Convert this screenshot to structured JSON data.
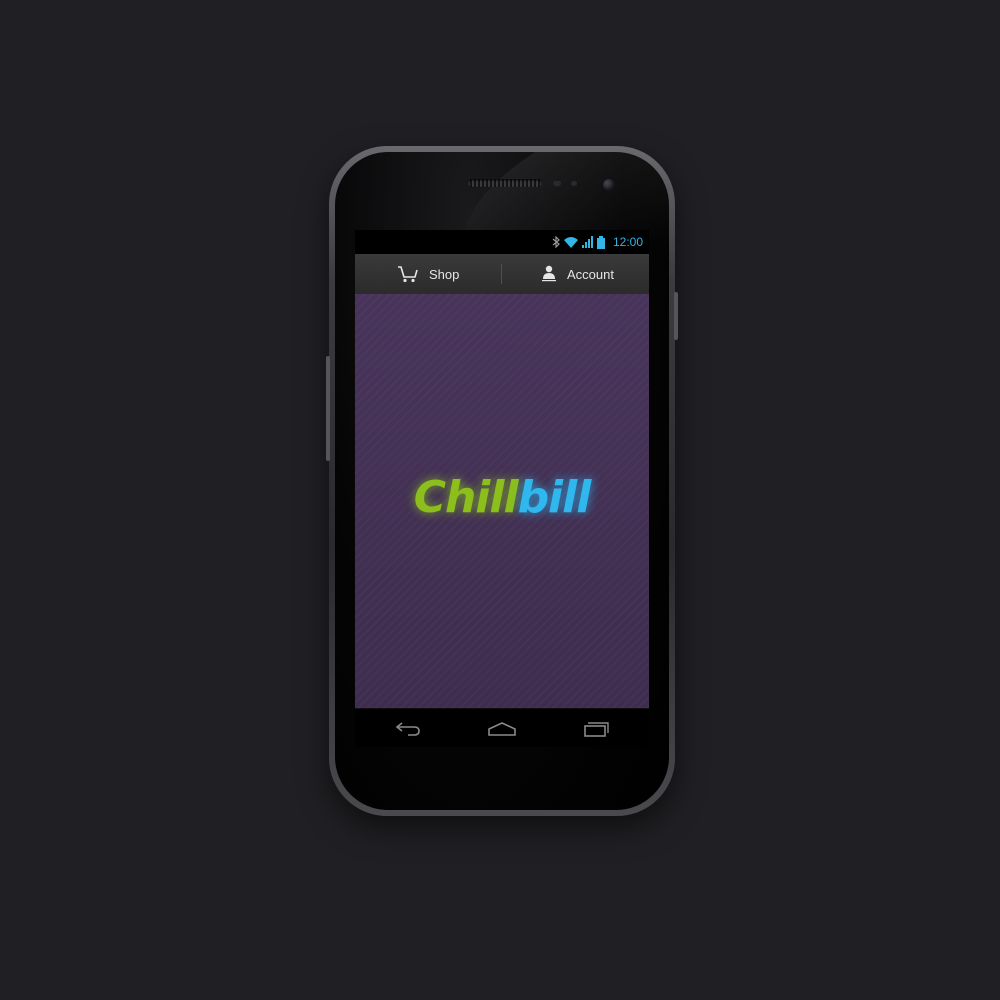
{
  "status_bar": {
    "time": "12:00",
    "icons": [
      "bluetooth-icon",
      "wifi-icon",
      "signal-icon",
      "battery-icon"
    ],
    "accent_color": "#33b5e5"
  },
  "action_bar": {
    "tabs": [
      {
        "label": "Shop",
        "icon": "cart-icon"
      },
      {
        "label": "Account",
        "icon": "user-icon"
      }
    ]
  },
  "logo": {
    "part1": "Chill",
    "part2": "bill",
    "color_part1": "#8cbf1c",
    "color_part2": "#2fb7ee"
  },
  "nav_bar": {
    "icons": [
      "back-icon",
      "home-icon",
      "recent-apps-icon"
    ]
  },
  "colors": {
    "background": "#202024",
    "content_background": "#43315a"
  }
}
